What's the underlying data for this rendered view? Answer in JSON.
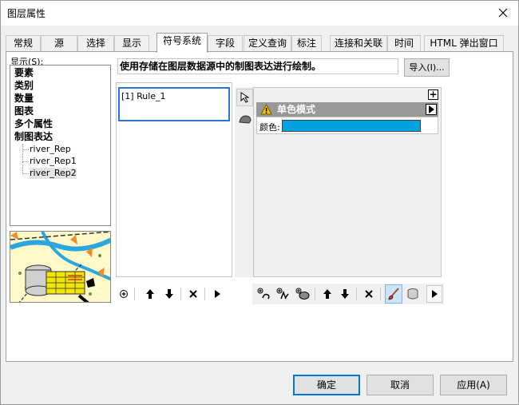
{
  "window": {
    "title": "图层属性"
  },
  "tabs": [
    {
      "label": "常规"
    },
    {
      "label": "源"
    },
    {
      "label": "选择"
    },
    {
      "label": "显示"
    },
    {
      "label": "符号系统"
    },
    {
      "label": "字段"
    },
    {
      "label": "定义查询"
    },
    {
      "label": "标注"
    },
    {
      "label": "连接和关联"
    },
    {
      "label": "时间"
    },
    {
      "label": "HTML 弹出窗口"
    }
  ],
  "active_tab": "符号系统",
  "show": {
    "label": "显示(S):",
    "items": [
      "要素",
      "类别",
      "数量",
      "图表",
      "多个属性",
      "制图表达"
    ],
    "children": [
      "river_Rep",
      "river_Rep1",
      "river_Rep2"
    ],
    "selected_child": "river_Rep2"
  },
  "description": "使用存储在图层数据源中的制图表达进行绘制。",
  "import_button": "导入(I)...",
  "rules": {
    "items": [
      "[1] Rule_1"
    ]
  },
  "layer": {
    "title": "单色模式",
    "color_label": "颜色:",
    "color_value": "#00a3e0"
  },
  "buttons": {
    "ok": "确定",
    "cancel": "取消",
    "apply": "应用(A)"
  },
  "colors": {
    "accent": "#0078d7",
    "selection_border": "#2b76d5",
    "layer_header": "#999999"
  }
}
